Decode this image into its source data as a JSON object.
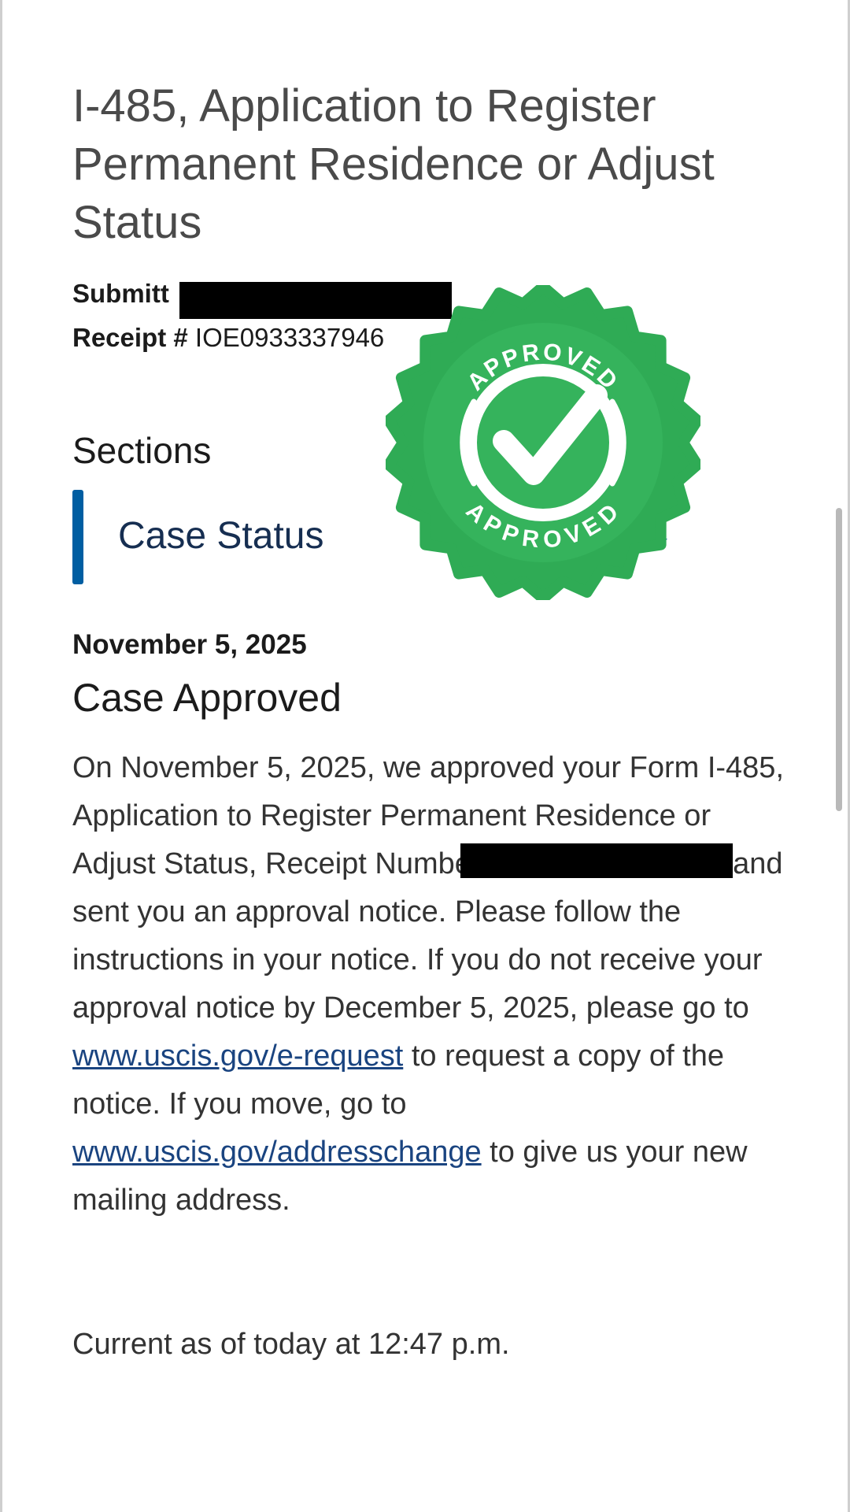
{
  "title": "I-485, Application to Register Permanent Residence or Adjust Status",
  "submitted_label": "Submitt",
  "receipt_label": "Receipt #",
  "receipt_value": "IOE0933337946",
  "sections_heading": "Sections",
  "case_status_label": "Case Status",
  "seal": {
    "top_text": "APPROVED",
    "bottom_text": "APPROVED",
    "color": "#2fab55"
  },
  "status_date": "November 5, 2025",
  "status_heading": "Case Approved",
  "body": {
    "p1": "On November 5, 2025, we approved your Form I-485, Application to Register Permanent Residence or Adjust Status, Receipt Number",
    "p2": "and sent you an approval notice. Please follow the instructions in your notice. If you do not receive your approval notice by December 5, 2025, please go to",
    "link1": "www.uscis.gov/e-request",
    "p3": "to request a copy of the notice. If you move, go to",
    "link2": "www.uscis.gov/addresschange",
    "p4": "to give us your new mailing address."
  },
  "current_as_of": "Current as of today at 12:47 p.m.",
  "colors": {
    "link": "#1a4480",
    "accent_bar": "#005ea2",
    "case_status_text": "#162e51"
  }
}
